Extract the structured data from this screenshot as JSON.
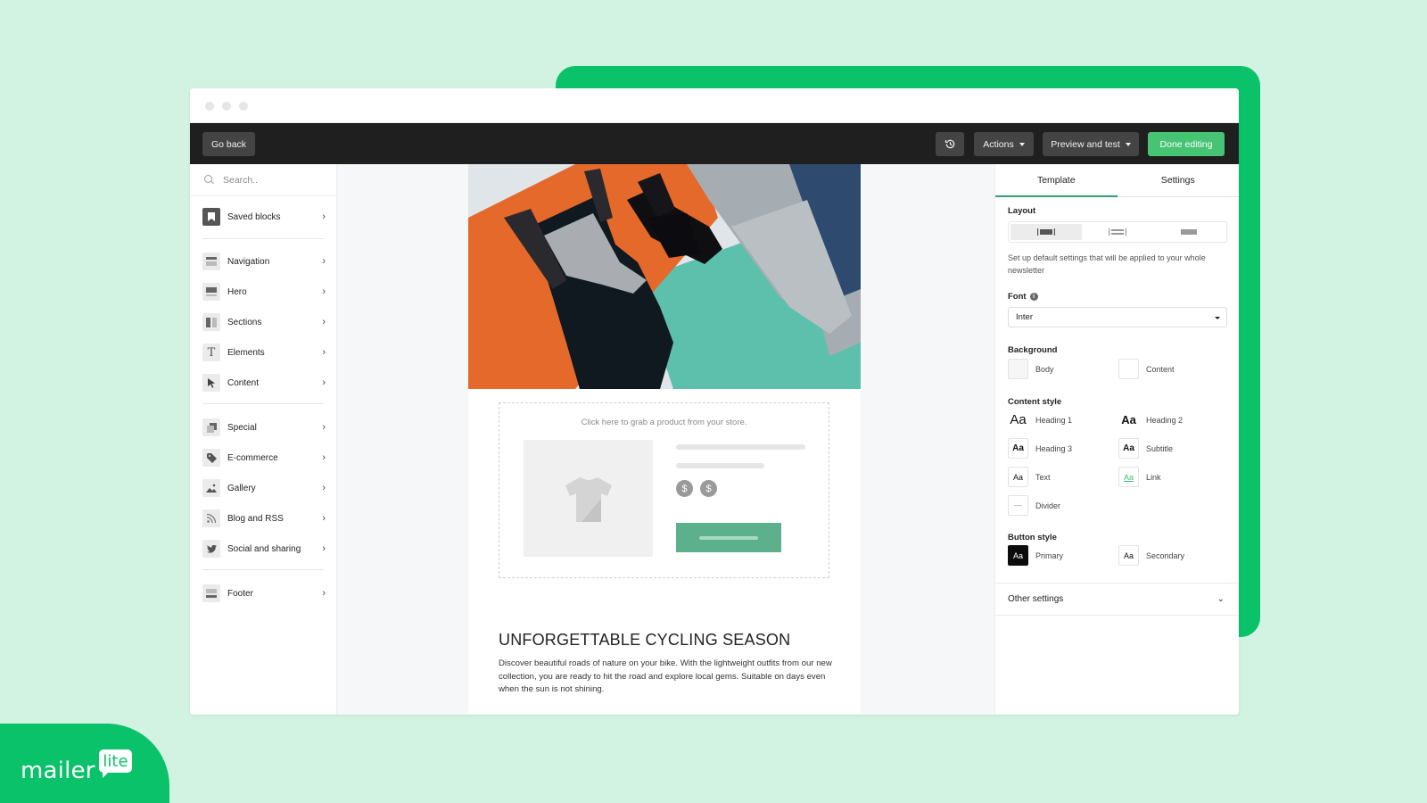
{
  "toolbar": {
    "go_back": "Go back",
    "history_icon": "history-icon",
    "actions": "Actions",
    "preview": "Preview and test",
    "done": "Done editing"
  },
  "sidebar": {
    "search_placeholder": "Search..",
    "items": [
      {
        "label": "Saved blocks",
        "icon": "bookmark-icon"
      },
      {
        "label": "Navigation",
        "icon": "navigation-block-icon"
      },
      {
        "label": "Hero",
        "icon": "hero-block-icon"
      },
      {
        "label": "Sections",
        "icon": "sections-icon"
      },
      {
        "label": "Elements",
        "icon": "text-icon"
      },
      {
        "label": "Content",
        "icon": "cursor-icon"
      },
      {
        "label": "Special",
        "icon": "special-icon"
      },
      {
        "label": "E-commerce",
        "icon": "tag-icon"
      },
      {
        "label": "Gallery",
        "icon": "image-icon"
      },
      {
        "label": "Blog and RSS",
        "icon": "rss-icon"
      },
      {
        "label": "Social and sharing",
        "icon": "twitter-icon"
      },
      {
        "label": "Footer",
        "icon": "footer-block-icon"
      }
    ]
  },
  "email": {
    "product_hint": "Click here to grab a product from your store.",
    "headline": "UNFORGETTABLE CYCLING SEASON",
    "paragraph": "Discover beautiful roads of nature on your bike. With the lightweight outfits from our new collection, you are ready to hit the road and explore local gems. Suitable on days even when the sun is not shining.",
    "price_symbol": "$"
  },
  "panel": {
    "tabs": [
      "Template",
      "Settings"
    ],
    "active_tab": "Template",
    "layout_label": "Layout",
    "layout_hint": "Set up default settings that will be applied to your whole newsletter",
    "font_label": "Font",
    "font_value": "Inter",
    "background_label": "Background",
    "background": [
      "Body",
      "Content"
    ],
    "content_style_label": "Content style",
    "content_styles": [
      {
        "sample": "Aa",
        "label": "Heading 1"
      },
      {
        "sample": "Aa",
        "label": "Heading 2"
      },
      {
        "sample": "Aa",
        "label": "Heading 3"
      },
      {
        "sample": "Aa",
        "label": "Subtitle"
      },
      {
        "sample": "Aa",
        "label": "Text"
      },
      {
        "sample": "Aa",
        "label": "Link"
      },
      {
        "sample": "",
        "label": "Divider"
      }
    ],
    "button_style_label": "Button style",
    "button_styles": [
      {
        "sample": "Aa",
        "label": "Primary"
      },
      {
        "sample": "Aa",
        "label": "Secondary"
      }
    ],
    "other_settings": "Other settings"
  },
  "brand": {
    "word": "mailer",
    "bubble": "lite"
  },
  "colors": {
    "brand_green": "#09c269",
    "done_button": "#47c374",
    "toolbar": "#1f1f1f",
    "product_button": "#5cb08c"
  }
}
